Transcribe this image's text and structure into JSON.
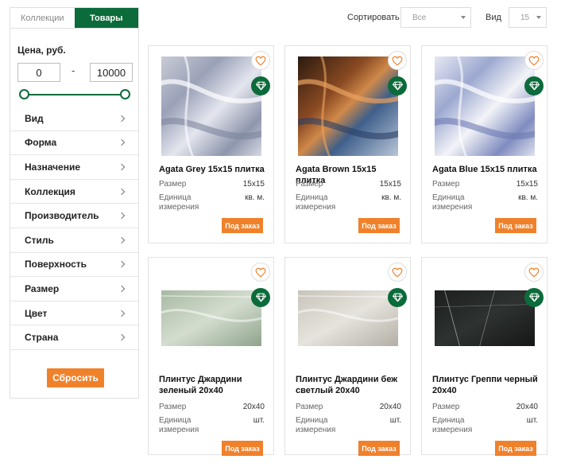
{
  "tabs": [
    {
      "label": "Коллекции",
      "active": false
    },
    {
      "label": "Товары",
      "active": true
    }
  ],
  "price": {
    "title": "Цена, руб.",
    "min": "0",
    "max": "10000",
    "dash": "-",
    "range_fraction": [
      0,
      1
    ]
  },
  "filters": [
    "Вид",
    "Форма",
    "Назначение",
    "Коллекция",
    "Производитель",
    "Стиль",
    "Поверхность",
    "Размер",
    "Цвет",
    "Страна"
  ],
  "reset_label": "Сбросить",
  "sort": {
    "label": "Сортировать",
    "value": "Все"
  },
  "view": {
    "label": "Вид",
    "value": "15"
  },
  "colors": {
    "brand_green": "#0b6b3a",
    "accent_orange": "#f0812b"
  },
  "products": [
    {
      "title": "Agata Grey 15x15 плитка",
      "size_label": "Размер",
      "size": "15x15",
      "unit_label": "Единица измерения",
      "unit": "кв. м.",
      "button": "Под заказ",
      "texture": "agate-grey"
    },
    {
      "title": "Agata Brown 15x15 плитка",
      "size_label": "Размер",
      "size": "15x15",
      "unit_label": "Единица измерения",
      "unit": "кв. м.",
      "button": "Под заказ",
      "texture": "agate-brown"
    },
    {
      "title": "Agata Blue 15x15 плитка",
      "size_label": "Размер",
      "size": "15x15",
      "unit_label": "Единица измерения",
      "unit": "кв. м.",
      "button": "Под заказ",
      "texture": "agate-blue"
    },
    {
      "title": "Плинтус Джардини зеленый 20x40",
      "size_label": "Размер",
      "size": "20x40",
      "unit_label": "Единица измерения",
      "unit": "шт.",
      "button": "Под заказ",
      "texture": "marble-green"
    },
    {
      "title": "Плинтус Джардини беж светлый 20x40",
      "size_label": "Размер",
      "size": "20x40",
      "unit_label": "Единица измерения",
      "unit": "шт.",
      "button": "Под заказ",
      "texture": "marble-beige"
    },
    {
      "title": "Плинтус Греппи черный 20x40",
      "size_label": "Размер",
      "size": "20x40",
      "unit_label": "Единица измерения",
      "unit": "шт.",
      "button": "Под заказ",
      "texture": "marble-black"
    }
  ]
}
